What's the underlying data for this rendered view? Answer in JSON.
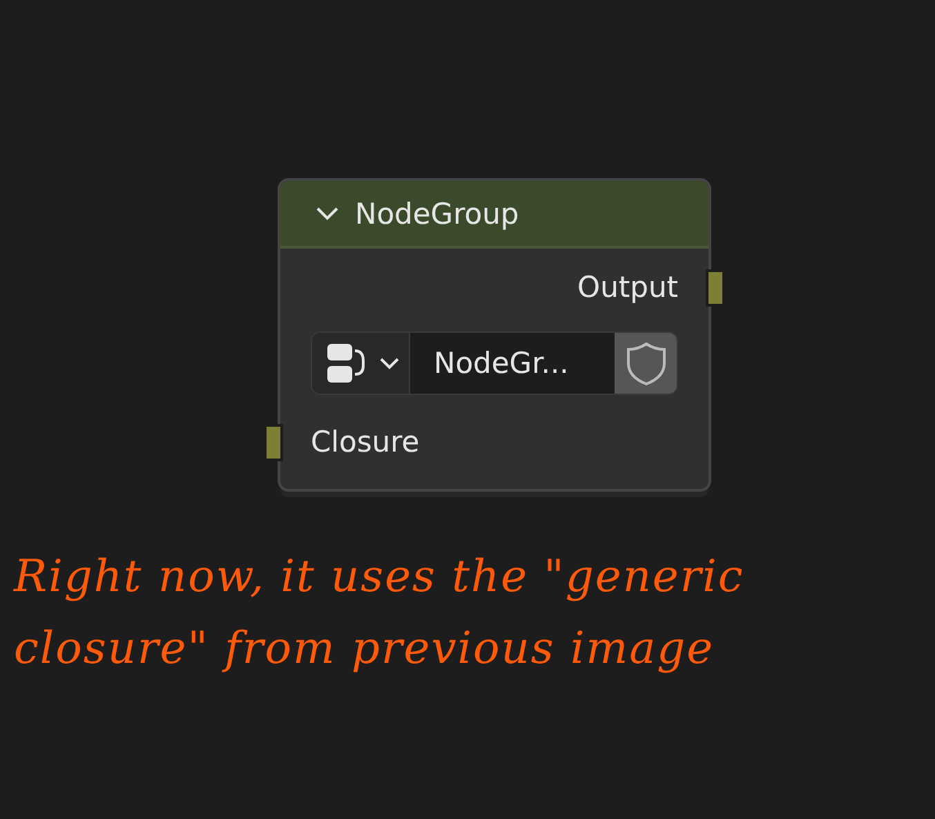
{
  "node": {
    "title": "NodeGroup",
    "expanded": true,
    "outputs": [
      {
        "label": "Output"
      }
    ],
    "group_selector": {
      "value": "NodeGr...",
      "fake_user": false
    },
    "inputs": [
      {
        "label": "Closure"
      }
    ]
  },
  "annotation": {
    "lines": [
      "Right now, it uses the \"generic",
      "closure\" from previous image"
    ]
  }
}
